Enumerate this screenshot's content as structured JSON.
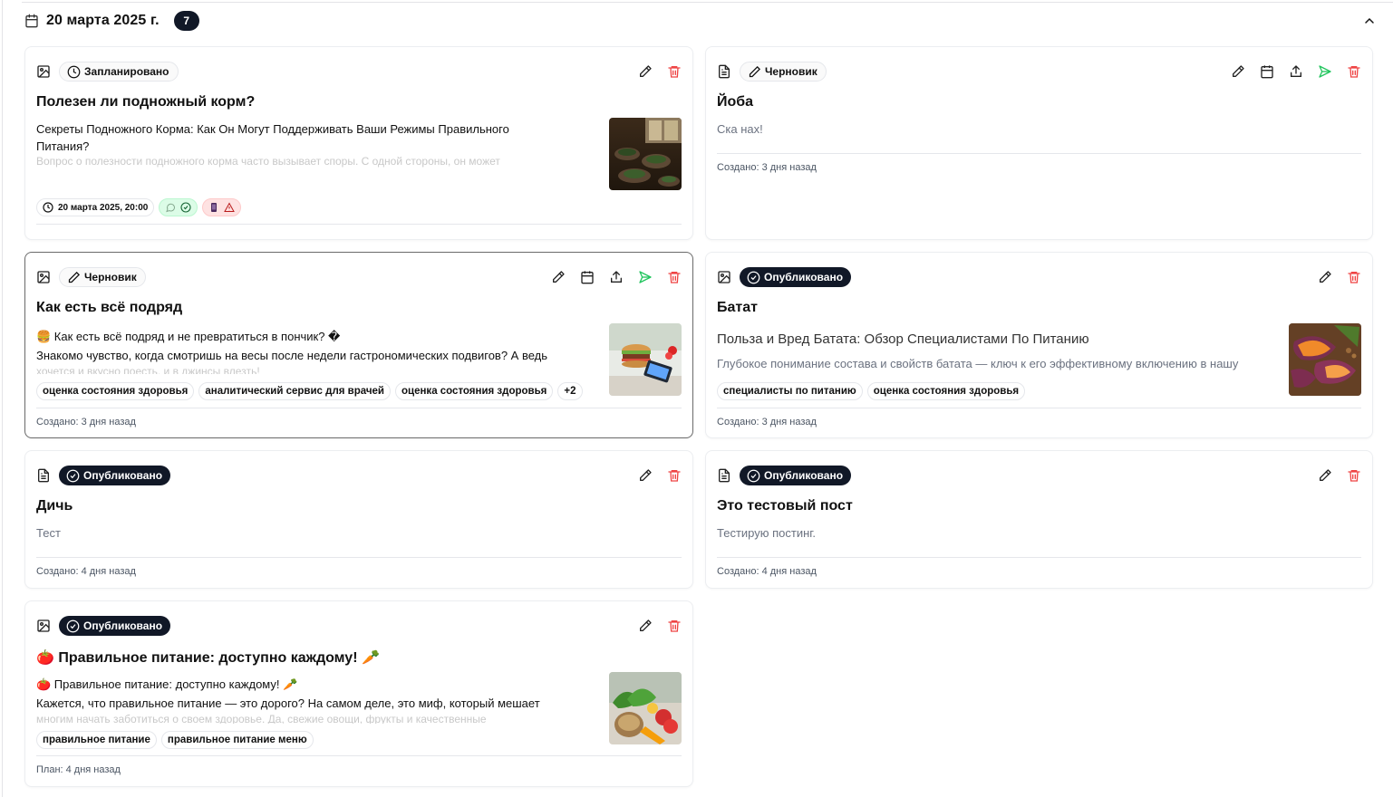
{
  "header": {
    "date": "20 марта 2025 г.",
    "count": "7"
  },
  "cards": {
    "c1": {
      "status": "Запланировано",
      "title": "Полезен ли подножный корм?",
      "desc_line1": "Секреты Подножного Корма: Как Он Могут Поддерживать Ваши Режимы Правильного",
      "desc_line2": "Питания?",
      "desc_fade": "Вопрос о полезности подножного корма часто вызывает споры. С одной стороны, он может",
      "schedule": "20 марта 2025, 20:00"
    },
    "c2": {
      "status": "Черновик",
      "title": "Йоба",
      "desc": "Ска нах!",
      "meta": "Создано: 3 дня назад"
    },
    "c3": {
      "status": "Черновик",
      "title": "Как есть всё подряд",
      "desc_line1": "🍔 Как есть всё подряд и не превратиться в пончик? �",
      "desc_line2": "Знакомо чувство, когда смотришь на весы после недели гастрономических подвигов? А ведь",
      "desc_fade": "хочется и вкусно поесть, и в джинсы влезть!",
      "tags": [
        "оценка состояния здоровья",
        "аналитический сервис для врачей",
        "оценка состояния здоровья",
        "+2"
      ],
      "meta": "Создано: 3 дня назад"
    },
    "c4": {
      "status": "Опубликовано",
      "title": "Батат",
      "subtitle": "Польза и Вред Батата: Обзор Специалистами По Питанию",
      "desc": "Глубокое понимание состава и свойств батата — ключ к его эффективному включению в нашу",
      "tags": [
        "специалисты по питанию",
        "оценка состояния здоровья"
      ],
      "meta": "Создано: 3 дня назад"
    },
    "c5": {
      "status": "Опубликовано",
      "title": "Дичь",
      "desc": "Тест",
      "meta": "Создано: 4 дня назад"
    },
    "c6": {
      "status": "Опубликовано",
      "title": "Это тестовый пост",
      "desc": "Тестирую постинг.",
      "meta": "Создано: 4 дня назад"
    },
    "c7": {
      "status": "Опубликовано",
      "title": "🍅 Правильное питание: доступно каждому! 🥕",
      "desc_line1": "🍅 Правильное питание: доступно каждому! 🥕",
      "desc_line2": "Кажется, что правильное питание — это дорого? На самом деле, это миф, который мешает",
      "desc_fade": "многим начать заботиться о своем здоровье. Да, свежие овощи, фрукты и качественные",
      "tags": [
        "правильное питание",
        "правильное питание меню"
      ],
      "meta": "План: 4 дня назад"
    }
  },
  "colors": {
    "accent_dark": "#111827",
    "publish_green": "#22c55e",
    "delete_red": "#ef4444"
  }
}
